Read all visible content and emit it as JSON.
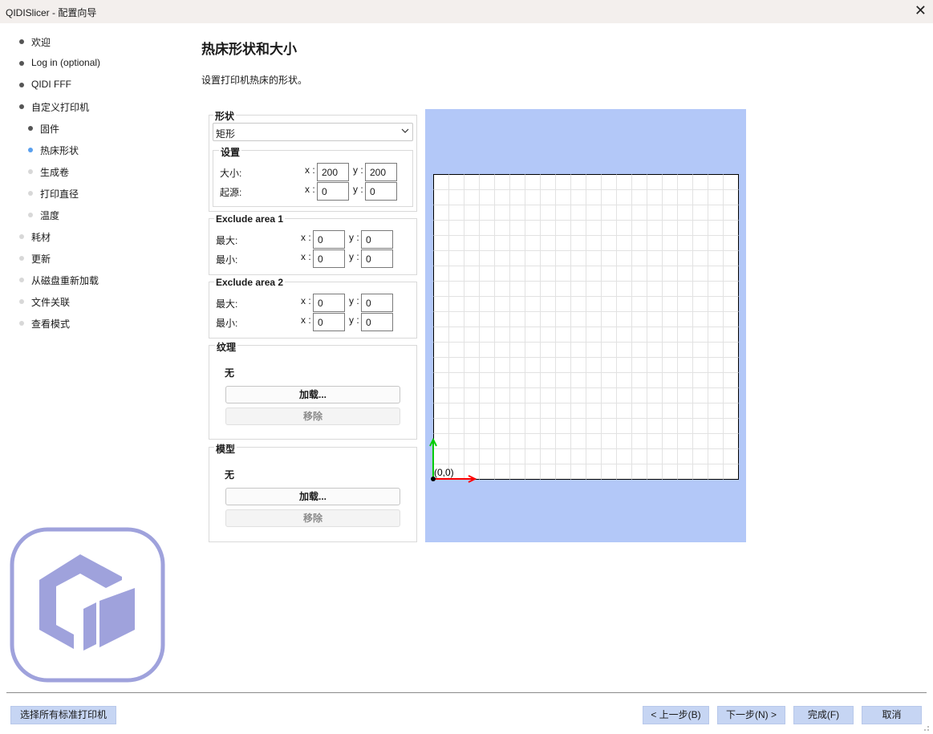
{
  "window": {
    "title": "QIDISlicer - 配置向导",
    "close_glyph": "✕"
  },
  "nav": {
    "items": [
      {
        "label": "欢迎",
        "state": "done"
      },
      {
        "label": "Log in (optional)",
        "state": "done"
      },
      {
        "label": "QIDI FFF",
        "state": "done"
      },
      {
        "label": "自定义打印机",
        "state": "done"
      },
      {
        "label": "固件",
        "state": "done"
      },
      {
        "label": "热床形状",
        "state": "active"
      },
      {
        "label": "生成卷",
        "state": "future"
      },
      {
        "label": "打印直径",
        "state": "future"
      },
      {
        "label": "温度",
        "state": "future"
      },
      {
        "label": "耗材",
        "state": "future"
      },
      {
        "label": "更新",
        "state": "future"
      },
      {
        "label": "从磁盘重新加载",
        "state": "future"
      },
      {
        "label": "文件关联",
        "state": "future"
      },
      {
        "label": "查看模式",
        "state": "future"
      }
    ]
  },
  "page": {
    "title": "热床形状和大小",
    "description": "设置打印机热床的形状。"
  },
  "shape": {
    "label": "形状",
    "selected": "矩形",
    "settings_label": "设置",
    "size_label": "大小:",
    "origin_label": "起源:",
    "size_x": "200",
    "size_y": "200",
    "origin_x": "0",
    "origin_y": "0"
  },
  "axis": {
    "x": "x :",
    "y": "y :"
  },
  "exclude1": {
    "label": "Exclude area 1",
    "max_label": "最大:",
    "min_label": "最小:",
    "max_x": "0",
    "max_y": "0",
    "min_x": "0",
    "min_y": "0"
  },
  "exclude2": {
    "label": "Exclude area 2",
    "max_label": "最大:",
    "min_label": "最小:",
    "max_x": "0",
    "max_y": "0",
    "min_x": "0",
    "min_y": "0"
  },
  "texture": {
    "label": "纹理",
    "value": "无",
    "load_button": "加载...",
    "remove_button": "移除"
  },
  "model": {
    "label": "模型",
    "value": "无",
    "load_button": "加载...",
    "remove_button": "移除"
  },
  "preview": {
    "origin_label": "(0,0)",
    "grid_cells": 20,
    "colors": {
      "background": "#b3c8f8",
      "x_axis": "#ff0000",
      "y_axis": "#00cc00"
    }
  },
  "footer": {
    "select_all": "选择所有标准打印机",
    "back": "< 上一步(B)",
    "next": "下一步(N) >",
    "finish": "完成(F)",
    "cancel": "取消"
  },
  "colors": {
    "active_dot": "#5aa0ee",
    "logo": "#9fa2dc",
    "footer_button": "#c6d5f3"
  }
}
